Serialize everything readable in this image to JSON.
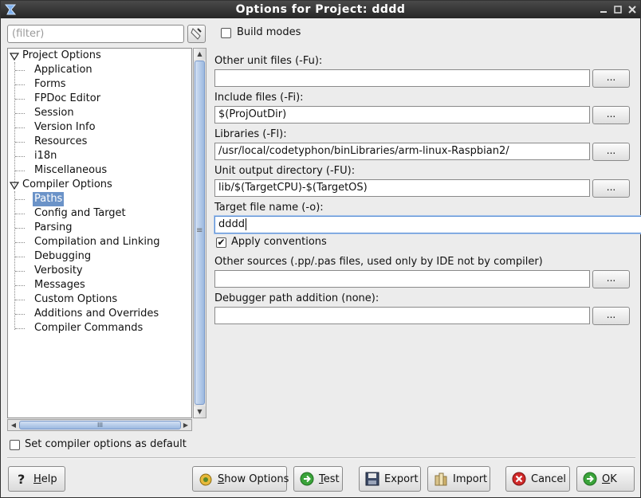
{
  "window": {
    "title": "Options for Project: dddd",
    "controls": [
      "minimize-icon",
      "maximize-icon",
      "close-icon"
    ]
  },
  "filter": {
    "placeholder": "(filter)",
    "value": ""
  },
  "tree": {
    "groups": [
      {
        "label": "Project Options",
        "expanded": true,
        "children": [
          "Application",
          "Forms",
          "FPDoc Editor",
          "Session",
          "Version Info",
          "Resources",
          "i18n",
          "Miscellaneous"
        ]
      },
      {
        "label": "Compiler Options",
        "expanded": true,
        "children": [
          "Paths",
          "Config and Target",
          "Parsing",
          "Compilation and Linking",
          "Debugging",
          "Verbosity",
          "Messages",
          "Custom Options",
          "Additions and Overrides",
          "Compiler Commands"
        ]
      }
    ],
    "selected": "Paths"
  },
  "scrollbars": {
    "horizontal_grip": "III",
    "splitter_grip": "≡"
  },
  "build_modes": {
    "label": "Build modes",
    "checked": false
  },
  "fields": {
    "other_unit_files": {
      "label": "Other unit files (-Fu):",
      "value": "",
      "button": "..."
    },
    "include_files": {
      "label": "Include files (-Fi):",
      "value": "$(ProjOutDir)",
      "button": "..."
    },
    "libraries": {
      "label": "Libraries (-Fl):",
      "value": "/usr/local/codetyphon/binLibraries/arm-linux-Raspbian2/",
      "button": "..."
    },
    "unit_output_dir": {
      "label": "Unit output directory (-FU):",
      "value": "lib/$(TargetCPU)-$(TargetOS)",
      "button": "..."
    },
    "target_file_name": {
      "label": "Target file name (-o):",
      "value": "dddd"
    },
    "other_sources": {
      "label": "Other sources (.pp/.pas files, used only by IDE not by compiler)",
      "value": "",
      "button": "..."
    },
    "debugger_path": {
      "label": "Debugger path addition (none):",
      "value": "",
      "button": "..."
    }
  },
  "apply_conventions": {
    "label": "Apply conventions",
    "checked": true,
    "mark": "✔"
  },
  "set_default": {
    "label": "Set compiler options as default",
    "checked": false
  },
  "buttons": {
    "help": {
      "accel": "H",
      "rest": "elp",
      "icon": "help-icon"
    },
    "show_options": {
      "accel": "S",
      "rest": "how Options",
      "icon": "show-options-icon"
    },
    "test": {
      "accel": "T",
      "rest": "est",
      "icon": "test-icon"
    },
    "export": {
      "label": "Export",
      "icon": "save-icon"
    },
    "import": {
      "label": "Import",
      "icon": "import-icon"
    },
    "cancel": {
      "label": "Cancel",
      "icon": "cancel-icon"
    },
    "ok": {
      "accel": "O",
      "rest": "K",
      "icon": "ok-icon"
    }
  },
  "colors": {
    "selection": "#6b93c8",
    "titlebar": "#2e2e2e",
    "ok_green": "#3aa33a",
    "cancel_red": "#d02a2a"
  }
}
